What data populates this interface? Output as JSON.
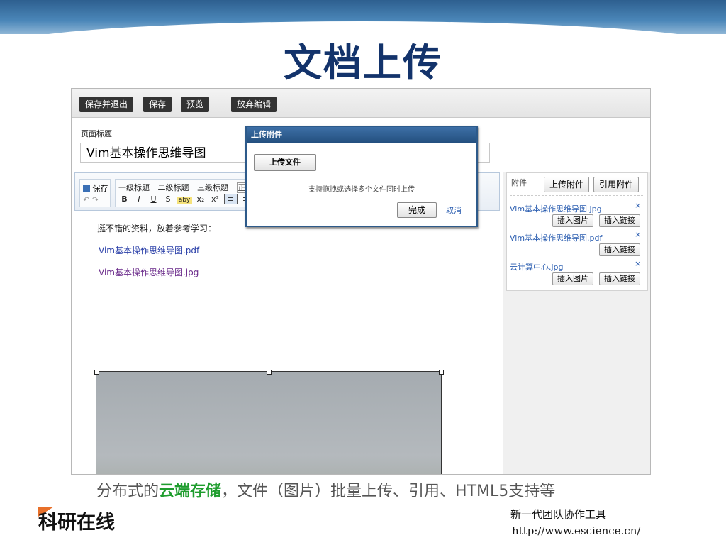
{
  "slide": {
    "title": "文档上传",
    "caption_pre": "分布式的",
    "caption_highlight": "云端存储",
    "caption_post": "，文件（图片）批量上传、引用、HTML5支持等",
    "logo_text": "科研在线",
    "footer_text": "新一代团队协作工具",
    "footer_url": "http://www.escience.cn/"
  },
  "toolbar": {
    "save_exit": "保存并退出",
    "save": "保存",
    "preview": "预览",
    "discard": "放弃编辑"
  },
  "page": {
    "title_label": "页面标题",
    "title_value": "Vim基本操作思维导图"
  },
  "editor_toolbar": {
    "save": "保存",
    "headings": [
      "一级标题",
      "二级标题",
      "三级标题",
      "正文"
    ],
    "format_buttons": [
      "B",
      "I",
      "U",
      "S",
      "aby",
      "x₂",
      "x²"
    ]
  },
  "content": {
    "intro": "挺不错的资料，放着参考学习：",
    "link_pdf": "Vim基本操作思维导图.pdf",
    "link_jpg": "Vim基本操作思维导图.jpg"
  },
  "attachments": {
    "label": "附件",
    "upload_button": "上传附件",
    "reference_button": "引用附件",
    "insert_image": "插入图片",
    "insert_link": "插入链接",
    "remove": "×",
    "items": [
      {
        "name": "Vim基本操作思维导图.jpg"
      },
      {
        "name": "Vim基本操作思维导图.pdf"
      },
      {
        "name": "云计算中心.jpg"
      }
    ]
  },
  "dialog": {
    "title": "上传附件",
    "upload_button": "上传文件",
    "hint": "支持拖拽或选择多个文件同时上传",
    "done": "完成",
    "cancel": "取消"
  },
  "colors": {
    "title": "#13336b",
    "highlight": "#1f9d2e",
    "link": "#2a5db0",
    "dialog_header": "#2d5a8a"
  }
}
